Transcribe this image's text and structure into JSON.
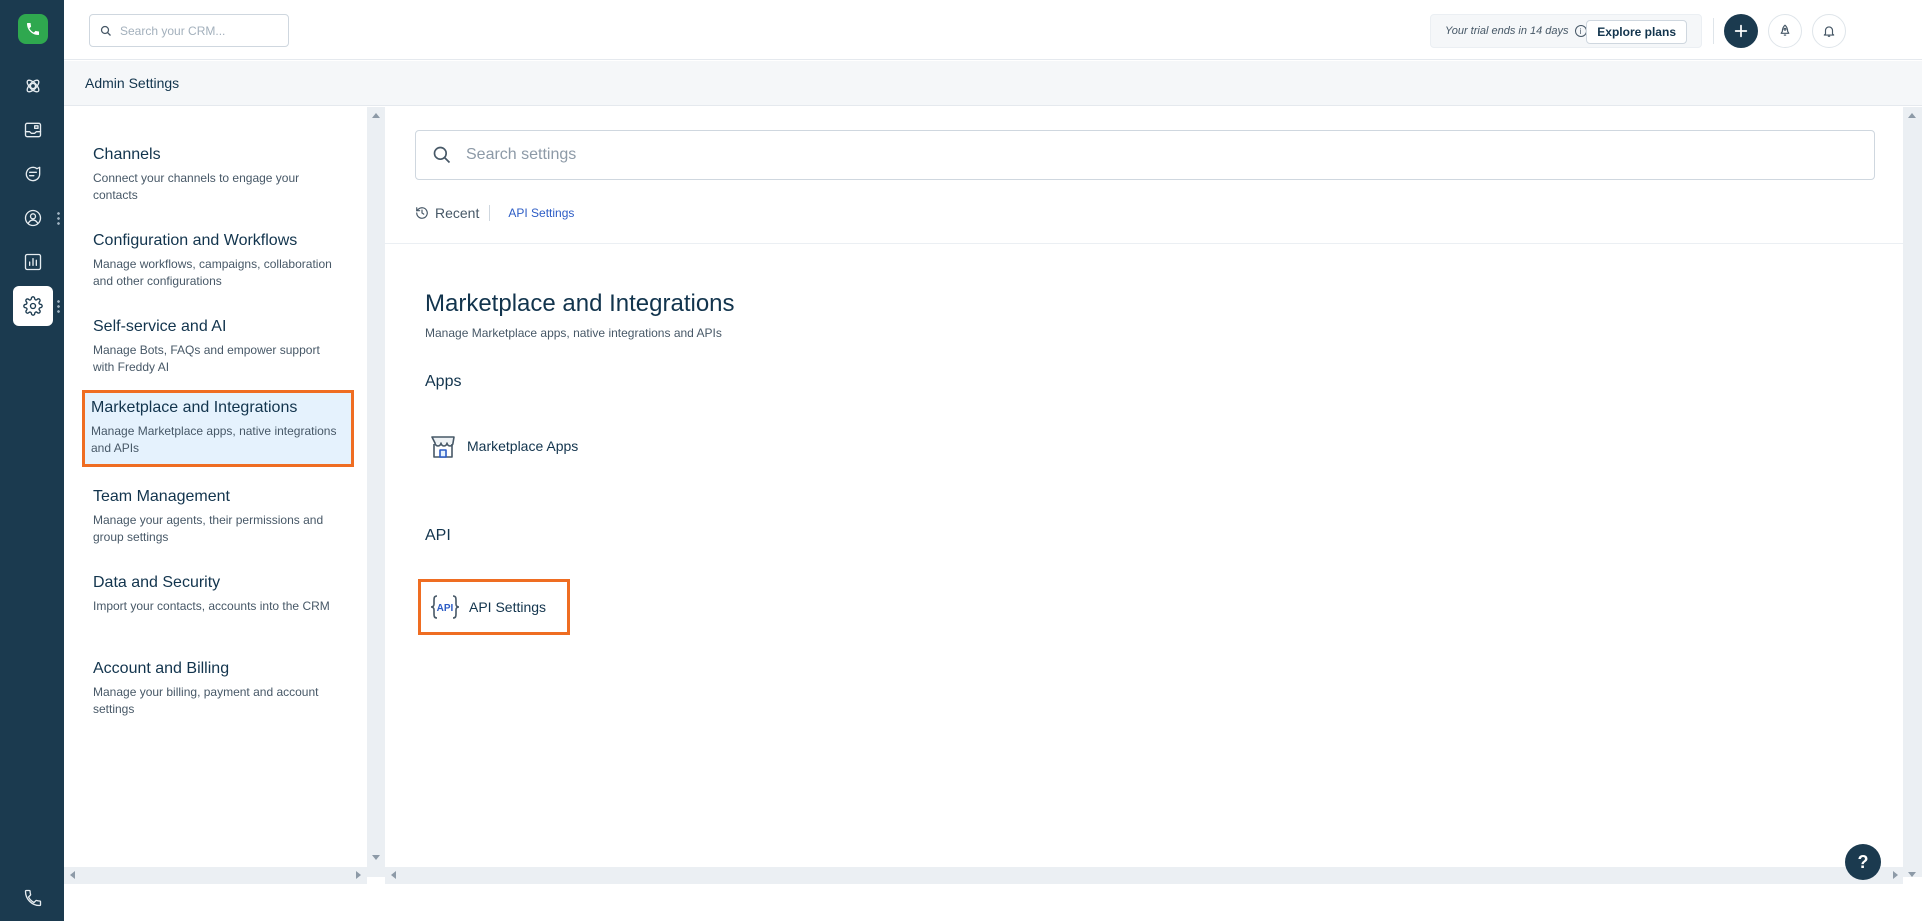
{
  "topbar": {
    "crm_search_placeholder": "Search your CRM...",
    "trial_text": "Your trial ends in 14 days",
    "explore_plans_label": "Explore plans"
  },
  "subheader": {
    "title": "Admin Settings"
  },
  "nav": {
    "items": [
      {
        "title": "Channels",
        "desc": "Connect your channels to engage your contacts"
      },
      {
        "title": "Configuration and Workflows",
        "desc": "Manage workflows, campaigns, collaboration and other configurations"
      },
      {
        "title": "Self-service and AI",
        "desc": "Manage Bots, FAQs and empower support with Freddy AI"
      },
      {
        "title": "Marketplace and Integrations",
        "desc": "Manage Marketplace apps, native integrations and APIs"
      },
      {
        "title": "Team Management",
        "desc": "Manage your agents, their permissions and group settings"
      },
      {
        "title": "Data and Security",
        "desc": "Import your contacts, accounts into the CRM"
      },
      {
        "title": "Account and Billing",
        "desc": "Manage your billing, payment and account settings"
      }
    ],
    "selected_index": 3
  },
  "main": {
    "search_placeholder": "Search settings",
    "recent_label": "Recent",
    "recent_links": [
      "API Settings"
    ],
    "section_title": "Marketplace and Integrations",
    "section_desc": "Manage Marketplace apps, native integrations and APIs",
    "groups": [
      {
        "heading": "Apps",
        "tiles": [
          {
            "label": "Marketplace Apps",
            "icon": "store-icon"
          }
        ]
      },
      {
        "heading": "API",
        "tiles": [
          {
            "label": "API Settings",
            "icon": "api-icon",
            "icon_text": "API"
          }
        ]
      }
    ]
  },
  "help": {
    "label": "?"
  },
  "colors": {
    "rail": "#1b3a4f",
    "brand_green": "#2fa84f",
    "highlight": "#ef6d22",
    "selected_bg": "#e5f2fd",
    "link": "#2c5cc5"
  }
}
